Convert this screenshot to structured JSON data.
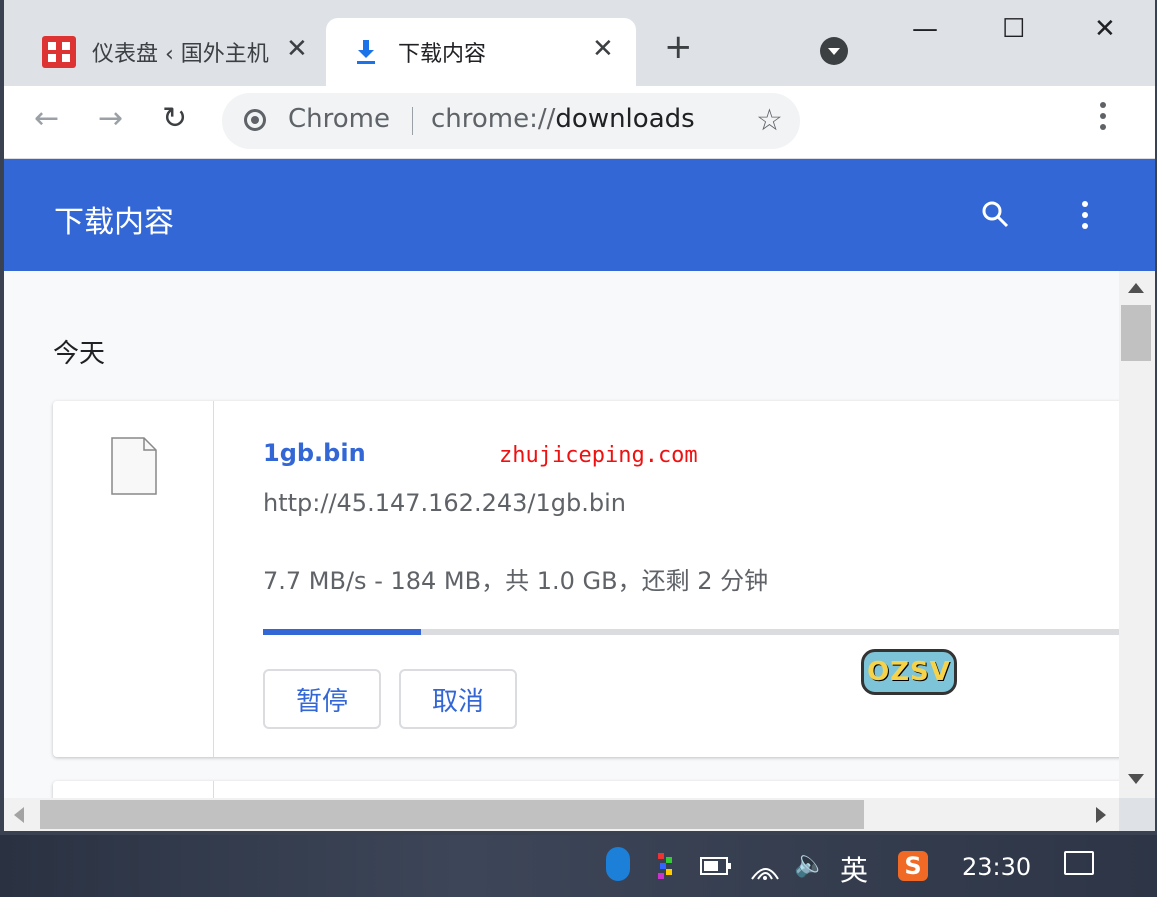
{
  "tabs": [
    {
      "title": "仪表盘 ‹ 国外主机",
      "close": "✕"
    },
    {
      "title": "下载内容",
      "close": "✕"
    }
  ],
  "new_tab": "+",
  "window_controls": {
    "minimize": "—",
    "maximize": "☐",
    "close": "✕"
  },
  "nav": {
    "back": "←",
    "forward": "→",
    "reload": "↻"
  },
  "omnibox": {
    "chip": "Chrome",
    "url_scheme": "chrome://",
    "url_host": "downloads",
    "star": "☆"
  },
  "appbar": {
    "title": "下载内容"
  },
  "date_header": "今天",
  "download": {
    "file_name": "1gb.bin",
    "url": "http://45.147.162.243/1gb.bin",
    "status": "7.7 MB/s - 184 MB，共 1.0 GB，还剩 2 分钟",
    "progress_fraction": 0.184,
    "pause_label": "暂停",
    "cancel_label": "取消"
  },
  "watermark": "zhujiceping.com",
  "logo_text": "OZSV",
  "taskbar": {
    "ime_label": "英",
    "sogou_label": "S",
    "clock": "23:30",
    "volume": "🔈"
  },
  "colors": {
    "accent": "#3367d6",
    "watermark": "#ee1111"
  }
}
